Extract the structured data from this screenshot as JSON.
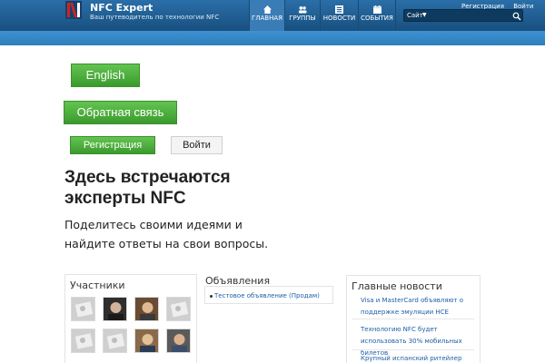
{
  "header": {
    "site_title": "NFC Expert",
    "site_subtitle": "Ваш путеводитель по технологии NFC",
    "nav": [
      {
        "label": "ГЛАВНАЯ",
        "icon": "home-icon"
      },
      {
        "label": "ГРУППЫ",
        "icon": "groups-icon"
      },
      {
        "label": "НОВОСТИ",
        "icon": "news-icon"
      },
      {
        "label": "СОБЫТИЯ",
        "icon": "events-icon"
      }
    ],
    "top_links": {
      "register": "Регистрация",
      "login": "Войти"
    },
    "search": {
      "scope": "Сайт",
      "placeholder": ""
    }
  },
  "buttons": {
    "english": "English",
    "feedback": "Обратная связь",
    "register": "Регистрация",
    "login": "Войти"
  },
  "hero": {
    "title": "Здесь встречаются эксперты NFC",
    "text": "Поделитесь своими идеями и найдите ответы на свои вопросы."
  },
  "participants": {
    "title": "Участники",
    "avatars": [
      "placeholder",
      "photo",
      "photo",
      "placeholder",
      "placeholder",
      "placeholder",
      "photo",
      "photo"
    ]
  },
  "announcements": {
    "title": "Объявления",
    "items": [
      "Тестовое объявление (Продам)"
    ]
  },
  "news": {
    "title": "Главные новости",
    "items": [
      "Visa и MasterCard объявляют о поддержке эмуляции HCE",
      "Технологию NFC будет использовать 30% мобильных билетов",
      "Крупный испанский ритейлер"
    ]
  },
  "colors": {
    "header": "#1c5a8e",
    "band": "#3a8ac9",
    "green_button": "#4cae3d",
    "link": "#1d5fa8"
  }
}
